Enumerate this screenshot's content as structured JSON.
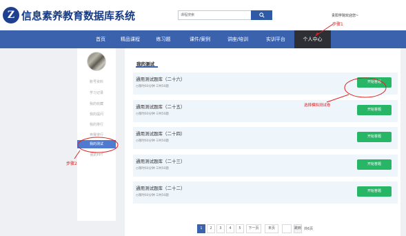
{
  "header": {
    "logo_letter": "Z",
    "logo_text": "信息素养教育数据库系统",
    "search_placeholder": "课程搜索",
    "welcome": "贵阳学院欢迎您~"
  },
  "nav": {
    "items": [
      "首页",
      "精品课程",
      "练习题",
      "课件/案例",
      "讲座/培训",
      "实训平台",
      "个人中心"
    ],
    "active_index": 6
  },
  "annotations": {
    "step1": "步骤1",
    "step2": "步骤2",
    "select_hint": "选择模拟测试卷"
  },
  "sidebar": {
    "items": [
      "账号资料",
      "学习记录",
      "我的收藏",
      "我的提问",
      "我的排行",
      "竞赛排行",
      "我的测试",
      "我的PPT"
    ],
    "active_index": 6
  },
  "main": {
    "section_title": "我的测试",
    "exams": [
      {
        "title": "通用测试题库（二十六）",
        "meta": "◷限时60分钟 ☰共50题",
        "button": "开始答题"
      },
      {
        "title": "通用测试题库（二十五）",
        "meta": "◷限时60分钟 ☰共50题",
        "button": "开始答题"
      },
      {
        "title": "通用测试题库（二十四）",
        "meta": "◷限时60分钟 ☰共50题",
        "button": "开始答题"
      },
      {
        "title": "通用测试题库（二十三）",
        "meta": "◷限时60分钟 ☰共50题",
        "button": "开始答题"
      },
      {
        "title": "通用测试题库（二十二）",
        "meta": "◷限时60分钟 ☰共50题",
        "button": "开始答题"
      }
    ]
  },
  "pagination": {
    "pages": [
      "1",
      "2",
      "3",
      "4",
      "5"
    ],
    "active_page": "1",
    "next": "下一页",
    "last": "末页",
    "goto_value": "",
    "jump": "跳到",
    "total": "共6页"
  },
  "colors": {
    "nav_bg": "#3a62ad",
    "nav_active": "#2d2f34",
    "button_green": "#27b566",
    "annotation_red": "#e02020"
  }
}
